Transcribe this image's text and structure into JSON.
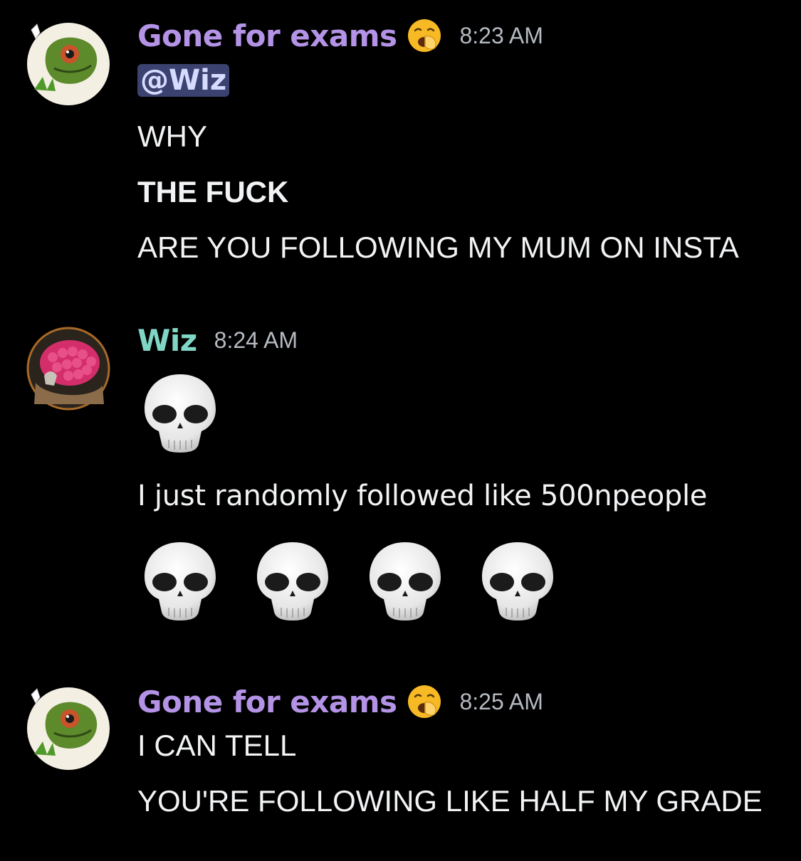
{
  "colors": {
    "background": "#000000",
    "gone_name": "#b493e6",
    "wiz_name": "#7fd6c4",
    "timestamp": "#b5bac1",
    "mention_bg": "#3c4270"
  },
  "messages": [
    {
      "author": "Gone for exams",
      "status_emoji": "yawning-face-icon",
      "time": "8:23 AM",
      "mention": "@Wiz",
      "lines": [
        "WHY",
        "THE FUCK",
        "ARE YOU FOLLOWING MY MUM ON INSTA"
      ]
    },
    {
      "author": "Wiz",
      "time": "8:24 AM",
      "line": "I just randomly followed like 500npeople"
    },
    {
      "author": "Gone for exams",
      "status_emoji": "yawning-face-icon",
      "time": "8:25 AM",
      "lines": [
        "I CAN TELL",
        "YOU'RE FOLLOWING LIKE HALF MY GRADE"
      ]
    }
  ]
}
